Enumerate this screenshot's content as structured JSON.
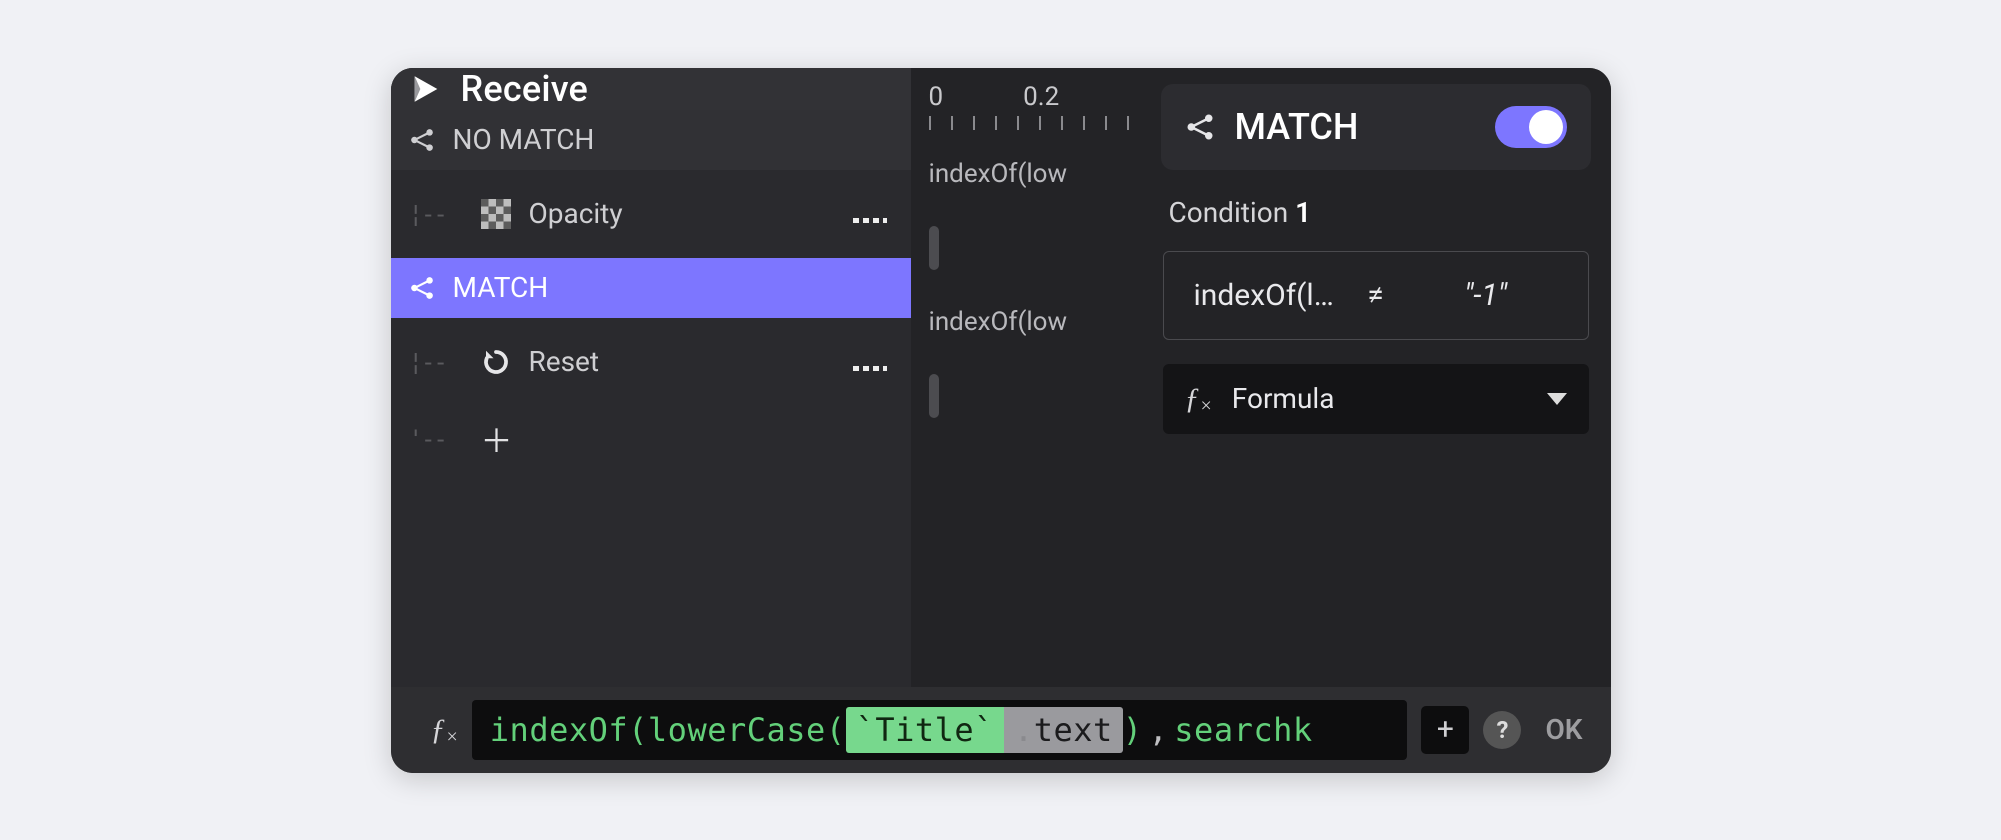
{
  "left": {
    "header": "Receive",
    "items": {
      "no_match": "NO MATCH",
      "opacity": "Opacity",
      "match": "MATCH",
      "reset": "Reset"
    }
  },
  "timeline": {
    "ticks": [
      "0",
      "0.2"
    ],
    "row1": "indexOf(low",
    "row2": "indexOf(low"
  },
  "right": {
    "title": "MATCH",
    "condition_label": "Condition",
    "condition_num": "1",
    "condition": {
      "lhs": "indexOf(lo...",
      "op": "≠",
      "rhs": "\"-1\""
    },
    "formula_label": "Formula"
  },
  "formula": {
    "fn1": "indexOf",
    "open1": "(",
    "fn2": "lowerCase",
    "open2": "(",
    "title": "`Title`",
    "dot": ".",
    "prop": "text",
    "close2": ")",
    "comma": ",",
    "var": "searchk",
    "add": "+",
    "help": "?",
    "ok": "OK"
  }
}
